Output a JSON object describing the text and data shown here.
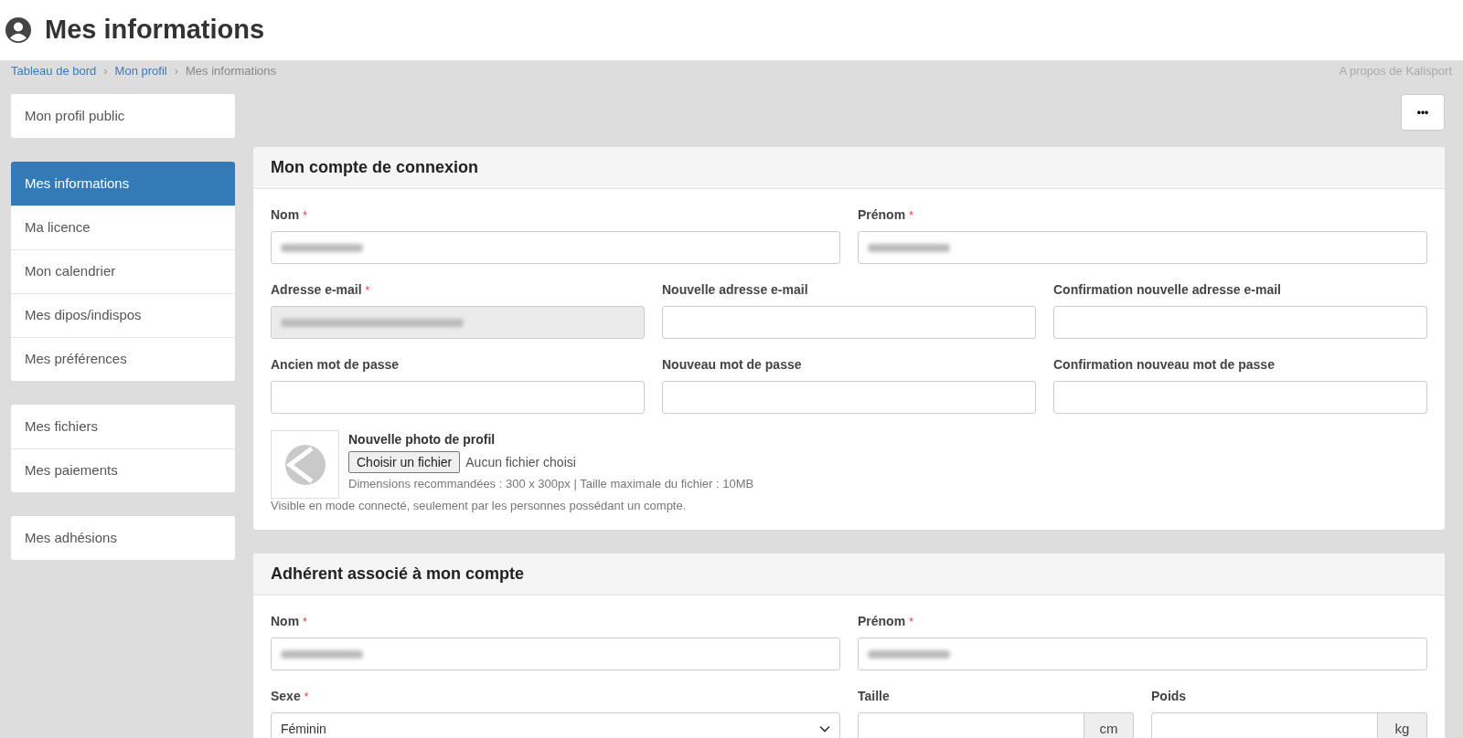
{
  "page_title": "Mes informations",
  "breadcrumb": [
    {
      "label": "Tableau de bord",
      "link": true
    },
    {
      "label": "Mon profil",
      "link": true
    },
    {
      "label": "Mes informations",
      "link": false
    }
  ],
  "breadcrumb_separator": "›",
  "required_mark": "*",
  "about_link": "A propos de Kalisport",
  "more_button": "•••",
  "sidebar": [
    {
      "items": [
        {
          "label": "Mon profil public",
          "selected": false
        }
      ]
    },
    {
      "items": [
        {
          "label": "Mes informations",
          "selected": true
        },
        {
          "label": "Ma licence",
          "selected": false
        },
        {
          "label": "Mon calendrier",
          "selected": false
        },
        {
          "label": "Mes dipos/indispos",
          "selected": false
        },
        {
          "label": "Mes préférences",
          "selected": false
        }
      ]
    },
    {
      "items": [
        {
          "label": "Mes fichiers",
          "selected": false
        },
        {
          "label": "Mes paiements",
          "selected": false
        }
      ]
    },
    {
      "items": [
        {
          "label": "Mes adhésions",
          "selected": false
        }
      ]
    }
  ],
  "sections": [
    {
      "title": "Mon compte de connexion",
      "rows": [
        [
          {
            "kind": "text",
            "label": "Nom",
            "required": true,
            "redacted": true,
            "disabled": false
          },
          {
            "kind": "text",
            "label": "Prénom",
            "required": true,
            "redacted": true,
            "disabled": false
          }
        ],
        [
          {
            "kind": "text",
            "label": "Adresse e-mail",
            "required": true,
            "redacted": true,
            "disabled": true
          },
          {
            "kind": "text",
            "label": "Nouvelle adresse e-mail",
            "required": false,
            "redacted": false,
            "disabled": false
          },
          {
            "kind": "text",
            "label": "Confirmation nouvelle adresse e-mail",
            "required": false,
            "redacted": false,
            "disabled": false
          }
        ],
        [
          {
            "kind": "text",
            "label": "Ancien mot de passe",
            "required": false,
            "redacted": false,
            "disabled": false
          },
          {
            "kind": "text",
            "label": "Nouveau mot de passe",
            "required": false,
            "redacted": false,
            "disabled": false
          },
          {
            "kind": "text",
            "label": "Confirmation nouveau mot de passe",
            "required": false,
            "redacted": false,
            "disabled": false
          }
        ]
      ],
      "photo": {
        "label": "Nouvelle photo de profil",
        "button": "Choisir un fichier",
        "status": "Aucun fichier choisi",
        "hint": "Dimensions recommandées : 300 x 300px | Taille maximale du fichier : 10MB",
        "note": "Visible en mode connecté, seulement par les personnes possédant un compte."
      }
    },
    {
      "title": "Adhérent associé à mon compte",
      "rows": [
        [
          {
            "kind": "text",
            "label": "Nom",
            "required": true,
            "redacted": true,
            "disabled": false
          },
          {
            "kind": "text",
            "label": "Prénom",
            "required": true,
            "redacted": true,
            "disabled": false
          }
        ],
        [
          {
            "kind": "select",
            "label": "Sexe",
            "required": true,
            "value": "Féminin"
          },
          {
            "kind": "unit",
            "label": "Taille",
            "required": false,
            "unit": "cm"
          },
          {
            "kind": "unit",
            "label": "Poids",
            "required": false,
            "unit": "kg"
          }
        ]
      ]
    }
  ]
}
